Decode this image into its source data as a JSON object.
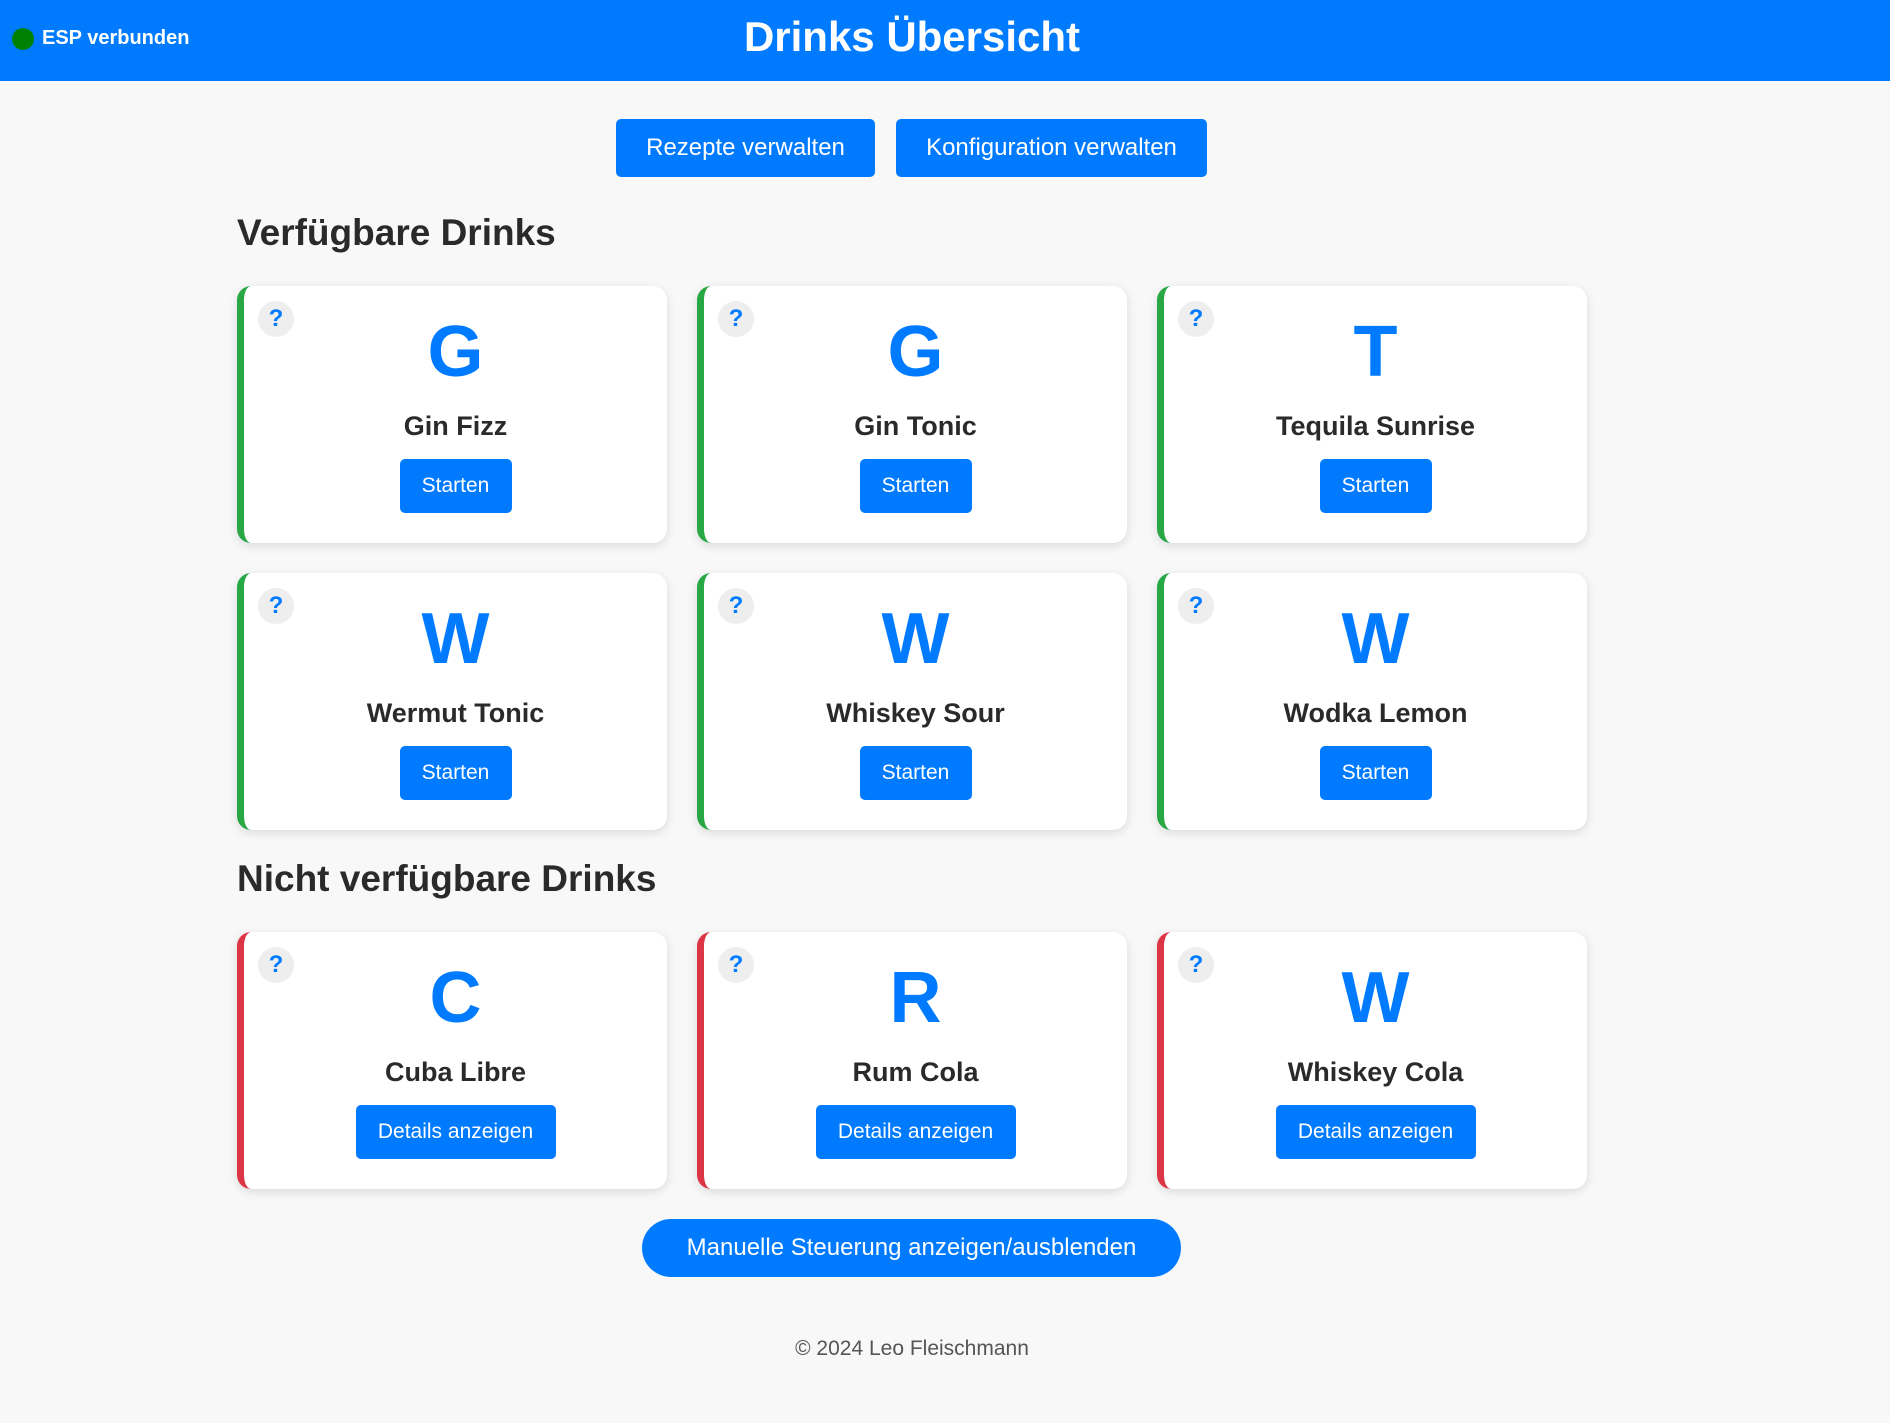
{
  "header": {
    "status_label": "ESP verbunden",
    "status_color": "#008000",
    "title": "Drinks Übersicht",
    "accent_color": "#007bff"
  },
  "toolbar": {
    "recipes_label": "Rezepte verwalten",
    "config_label": "Konfiguration verwalten"
  },
  "sections": {
    "available_title": "Verfügbare Drinks",
    "unavailable_title": "Nicht verfügbare Drinks"
  },
  "available": [
    {
      "letter": "G",
      "name": "Gin Fizz",
      "button": "Starten",
      "help": "?"
    },
    {
      "letter": "G",
      "name": "Gin Tonic",
      "button": "Starten",
      "help": "?"
    },
    {
      "letter": "T",
      "name": "Tequila Sunrise",
      "button": "Starten",
      "help": "?"
    },
    {
      "letter": "W",
      "name": "Wermut Tonic",
      "button": "Starten",
      "help": "?"
    },
    {
      "letter": "W",
      "name": "Whiskey Sour",
      "button": "Starten",
      "help": "?"
    },
    {
      "letter": "W",
      "name": "Wodka Lemon",
      "button": "Starten",
      "help": "?"
    }
  ],
  "unavailable": [
    {
      "letter": "C",
      "name": "Cuba Libre",
      "button": "Details anzeigen",
      "help": "?"
    },
    {
      "letter": "R",
      "name": "Rum Cola",
      "button": "Details anzeigen",
      "help": "?"
    },
    {
      "letter": "W",
      "name": "Whiskey Cola",
      "button": "Details anzeigen",
      "help": "?"
    }
  ],
  "status_colors": {
    "available": "#28a745",
    "unavailable": "#dc3545"
  },
  "manual_control_label": "Manuelle Steuerung anzeigen/ausblenden",
  "footer": "© 2024 Leo Fleischmann"
}
